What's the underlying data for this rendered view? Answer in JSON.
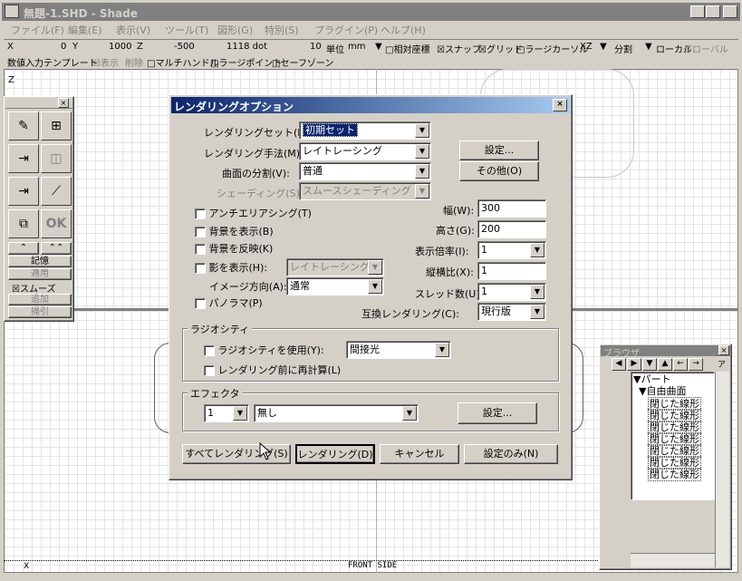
{
  "window": {
    "title": "無題-1.SHD - Shade",
    "min": "_",
    "max": "□",
    "close": "×"
  },
  "menu": [
    "ファイル(F)",
    "編集(E)",
    "表示(V)",
    "ツール(T)",
    "図形(G)",
    "特別(S)",
    "プラグイン(P)",
    "ヘルプ(H)"
  ],
  "coords": {
    "x": "X",
    "xv": "0",
    "y": "Y",
    "yv": "1000",
    "z": "Z",
    "zv": "-500",
    "dot": "1118 dot",
    "dotv": "10",
    "unit_lbl": "単位",
    "unit": "mm",
    "relcoord": "□相対座標",
    "snap": "☒スナップ",
    "grid": "☒グリッド",
    "largecursor": "□ラージカーソル",
    "plane": "XZ",
    "split": "分割",
    "local": "ローカル",
    "global": "グローバル"
  },
  "toolbar2": [
    "数値入力",
    "テンプレート",
    "☒表示",
    "削除",
    "□マルチハンドル",
    "□ラージポイント",
    "□セーフゾーン"
  ],
  "tools": {
    "ok": "OK",
    "memory": "記憶",
    "apply": "適用",
    "smooth": "☒スムーズ",
    "add": "追加",
    "pull": "掃引"
  },
  "viewport": {
    "axis_z": "Z",
    "axis_x": "X",
    "side": "FRONT SIDE"
  },
  "dialog": {
    "title": "レンダリングオプション",
    "render_set_lbl": "レンダリングセット(E):",
    "render_set": "初期セット",
    "method_lbl": "レンダリング手法(M):",
    "method": "レイトレーシング",
    "subdiv_lbl": "曲面の分割(V):",
    "subdiv": "普通",
    "shading_lbl": "シェーディング(S):",
    "shading": "スムースシェーディング",
    "settings_btn": "設定...",
    "other_btn": "その他(O)",
    "antialias": "アンチエリアシング(T)",
    "bg_show": "背景を表示(B)",
    "bg_reflect": "背景を反映(K)",
    "shadow": "影を表示(H):",
    "shadow_mode": "レイトレーシング",
    "image_dir_lbl": "イメージ方向(A):",
    "image_dir": "通常",
    "panorama": "パノラマ(P)",
    "width_lbl": "幅(W):",
    "width": "300",
    "height_lbl": "高さ(G):",
    "height": "200",
    "scale_lbl": "表示倍率(I):",
    "scale": "1",
    "aspect_lbl": "縦横比(X):",
    "aspect": "1",
    "threads_lbl": "スレッド数(U):",
    "threads": "1",
    "compat_lbl": "互換レンダリング(C):",
    "compat": "現行版",
    "radiosity_group": "ラジオシティ",
    "radiosity_use": "ラジオシティを使用(Y):",
    "radiosity_mode": "間接光",
    "recompute": "レンダリング前に再計算(L)",
    "effector_group": "エフェクタ",
    "effector_num": "1",
    "effector": "無し",
    "effector_btn": "設定...",
    "render_all": "すべてレンダリング(S)",
    "render": "レンダリング(D)",
    "cancel": "キャンセル",
    "settings_only": "設定のみ(N)"
  },
  "browser": {
    "title": "ブラウザ",
    "part": "パート",
    "freeform": "自由曲面",
    "items": [
      "閉じた線形",
      "閉じた線形",
      "閉じた線形",
      "閉じた線形",
      "閉じた線形",
      "閉じた線形",
      "閉じた線形"
    ]
  }
}
